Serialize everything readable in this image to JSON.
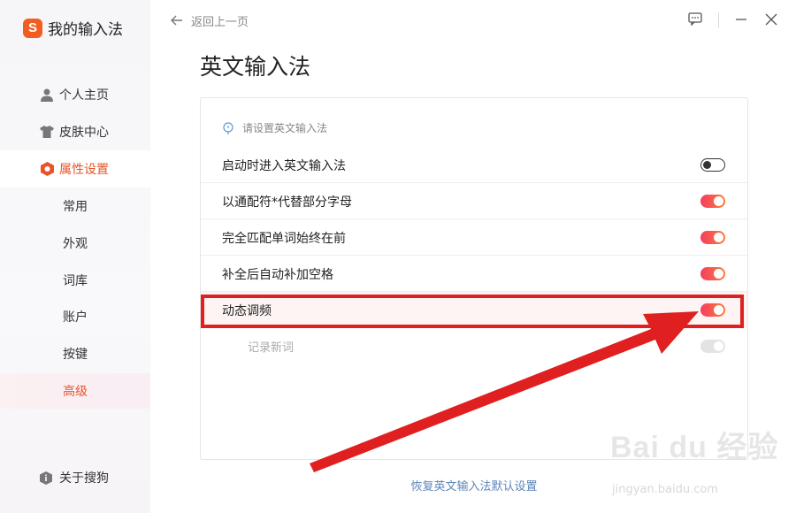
{
  "app": {
    "logo_char": "S",
    "title": "我的输入法"
  },
  "sidebar": {
    "items": [
      {
        "label": "个人主页",
        "icon": "person-icon"
      },
      {
        "label": "皮肤中心",
        "icon": "shirt-icon"
      },
      {
        "label": "属性设置",
        "icon": "hexagon-settings-icon",
        "active": true
      }
    ],
    "sub_items": [
      {
        "label": "常用"
      },
      {
        "label": "外观"
      },
      {
        "label": "词库"
      },
      {
        "label": "账户"
      },
      {
        "label": "按键"
      },
      {
        "label": "高级",
        "highlighted": true
      }
    ],
    "about_label": "关于搜狗"
  },
  "topbar": {
    "back_label": "返回上一页"
  },
  "page": {
    "title": "英文输入法",
    "tip": "请设置英文输入法",
    "rows": [
      {
        "label": "启动时进入英文输入法",
        "state": "off"
      },
      {
        "label": "以通配符*代替部分字母",
        "state": "on"
      },
      {
        "label": "完全匹配单词始终在前",
        "state": "on"
      },
      {
        "label": "补全后自动补加空格",
        "state": "on"
      },
      {
        "label": "动态调频",
        "state": "on"
      },
      {
        "label": "记录新词",
        "state": "disabled"
      }
    ],
    "reset_link": "恢复英文输入法默认设置"
  },
  "watermark": {
    "brand": "Bai du 经验",
    "url": "jingyan.baidu.com"
  },
  "colors": {
    "accent": "#e8542a",
    "annotation": "#e02020",
    "link": "#5b86b8"
  }
}
